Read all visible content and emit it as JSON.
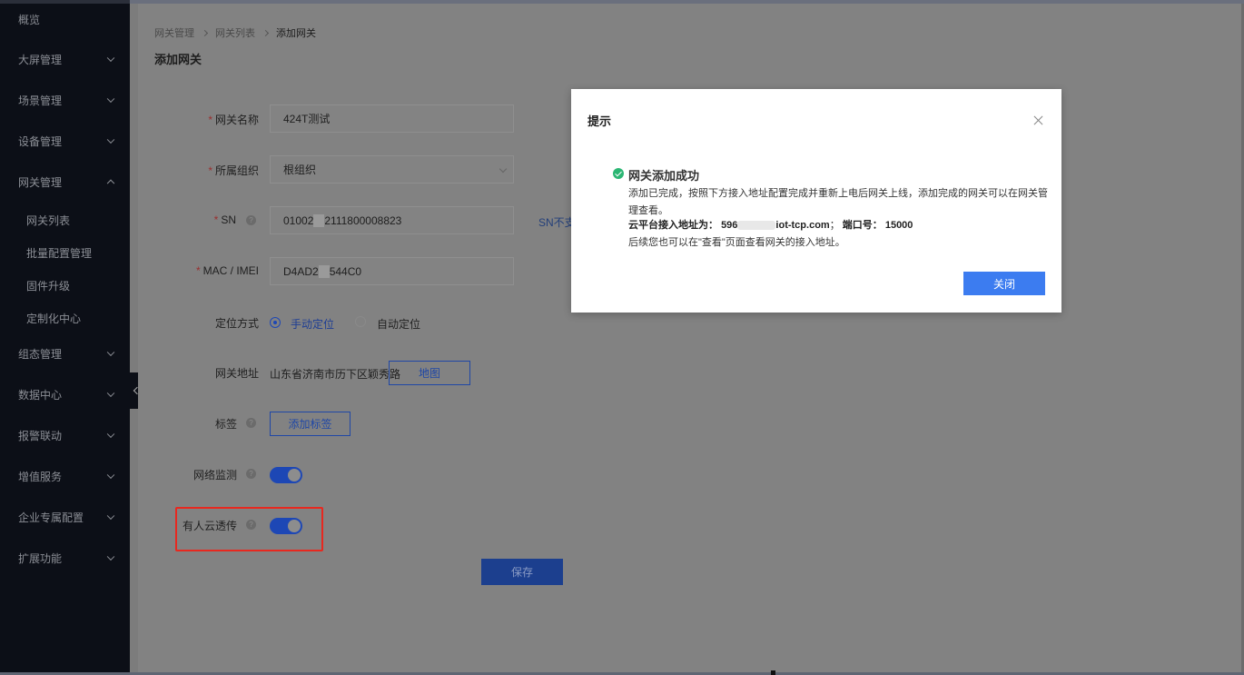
{
  "sidebar": {
    "items": [
      {
        "label": "概览"
      },
      {
        "label": "大屏管理"
      },
      {
        "label": "场景管理"
      },
      {
        "label": "设备管理"
      },
      {
        "label": "网关管理"
      },
      {
        "label": "组态管理"
      },
      {
        "label": "数据中心"
      },
      {
        "label": "报警联动"
      },
      {
        "label": "增值服务"
      },
      {
        "label": "企业专属配置"
      },
      {
        "label": "扩展功能"
      }
    ],
    "sub_items": [
      {
        "label": "网关列表"
      },
      {
        "label": "批量配置管理"
      },
      {
        "label": "固件升级"
      },
      {
        "label": "定制化中心"
      }
    ]
  },
  "breadcrumb": {
    "items": [
      "网关管理",
      "网关列表",
      "添加网关"
    ]
  },
  "page_title": "添加网关",
  "form": {
    "gateway_name": {
      "label": "网关名称",
      "value": "424T测试"
    },
    "org": {
      "label": "所属组织",
      "value": "根组织"
    },
    "sn": {
      "label": "SN",
      "value_prefix": "01002",
      "value_suffix": "2111800008823",
      "hint": "SN不支"
    },
    "mac": {
      "label": "MAC / IMEI",
      "value_prefix": "D4AD2",
      "value_suffix": "544C0"
    },
    "location_mode": {
      "label": "定位方式",
      "options": [
        "手动定位",
        "自动定位"
      ],
      "selected": "手动定位"
    },
    "address": {
      "label": "网关地址",
      "value": "山东省济南市历下区颖秀路",
      "map_button": "地图"
    },
    "tags": {
      "label": "标签",
      "add_button": "添加标签"
    },
    "network_monitor": {
      "label": "网络监测",
      "enabled": true
    },
    "usr_cloud_passthrough": {
      "label": "有人云透传",
      "enabled": true
    },
    "save_button": "保存"
  },
  "modal": {
    "title": "提示",
    "success_title": "网关添加成功",
    "line1": "添加已完成，按照下方接入地址配置完成并重新上电后网关上线，添加完成的网关可以在网关管",
    "line2": "理查看。",
    "addr_label": "云平台接入地址为：",
    "addr_prefix": "596",
    "addr_suffix": "iot-tcp.com",
    "addr_sep": "；",
    "port_label": "端口号：",
    "port_value": "15000",
    "line4": "后续您也可以在\"查看\"页面查看网关的接入地址。",
    "close_button": "关闭"
  },
  "colors": {
    "primary": "#3c7cf0",
    "success": "#2bb673",
    "highlight": "#e8281f"
  }
}
